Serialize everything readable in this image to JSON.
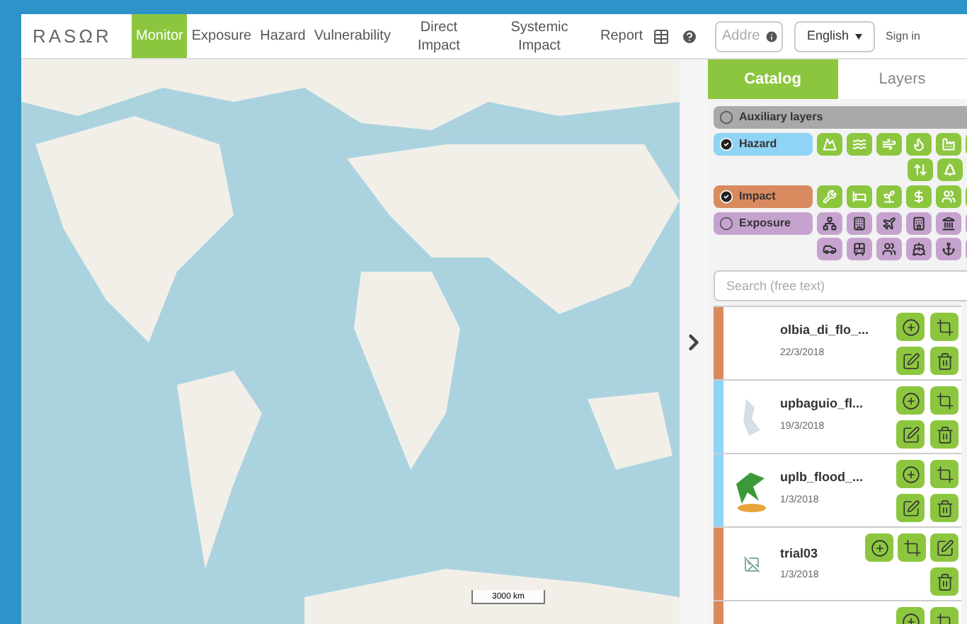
{
  "header": {
    "logo": "RASΩR",
    "nav": [
      {
        "label": "Monitor",
        "selected": true
      },
      {
        "label": "Exposure",
        "selected": false
      },
      {
        "label": "Hazard",
        "selected": false
      },
      {
        "label": "Vulnerability",
        "selected": false
      },
      {
        "label": "Direct Impact",
        "selected": false
      },
      {
        "label": "Systemic Impact",
        "selected": false
      },
      {
        "label": "Report",
        "selected": false
      }
    ],
    "address": {
      "placeholder": "Addre"
    },
    "language": "English",
    "sign_in": "Sign in"
  },
  "map": {
    "scale": "3000 km"
  },
  "panel": {
    "tabs": [
      {
        "label": "Catalog",
        "selected": true
      },
      {
        "label": "Layers",
        "selected": false
      }
    ],
    "categories": [
      {
        "kind": "auxiliary",
        "label": "Auxiliary layers",
        "checked": false,
        "color": "#a9a9a9"
      },
      {
        "kind": "hazard",
        "label": "Hazard",
        "checked": true,
        "color": "#8fd3f5"
      },
      {
        "kind": "impact",
        "label": "Impact",
        "checked": true,
        "color": "#d98b5f"
      },
      {
        "kind": "exposure",
        "label": "Exposure",
        "checked": false,
        "color": "#c6a3cf"
      }
    ],
    "search": {
      "placeholder": "Search (free text)"
    },
    "layers": [
      {
        "kind": "stacked",
        "name": "olbia_di_flo_...",
        "date": "22/3/2018",
        "color": "#d98b5f"
      },
      {
        "kind": "stacked",
        "name": "upbaguio_fl...",
        "date": "19/3/2018",
        "color": "#8fd3f5",
        "thumbnail": {
          "kind": "map"
        }
      },
      {
        "kind": "stacked",
        "name": "uplb_flood_...",
        "date": "1/3/2018",
        "color": "#8fd3f5",
        "thumbnail": {
          "kind": "logo"
        }
      },
      {
        "kind": "wide",
        "name": "trial03",
        "date": "1/3/2018",
        "color": "#d98b5f",
        "thumbnail": {
          "kind": "broken"
        }
      },
      {
        "kind": "stacked",
        "color": "#d98b5f"
      }
    ]
  }
}
